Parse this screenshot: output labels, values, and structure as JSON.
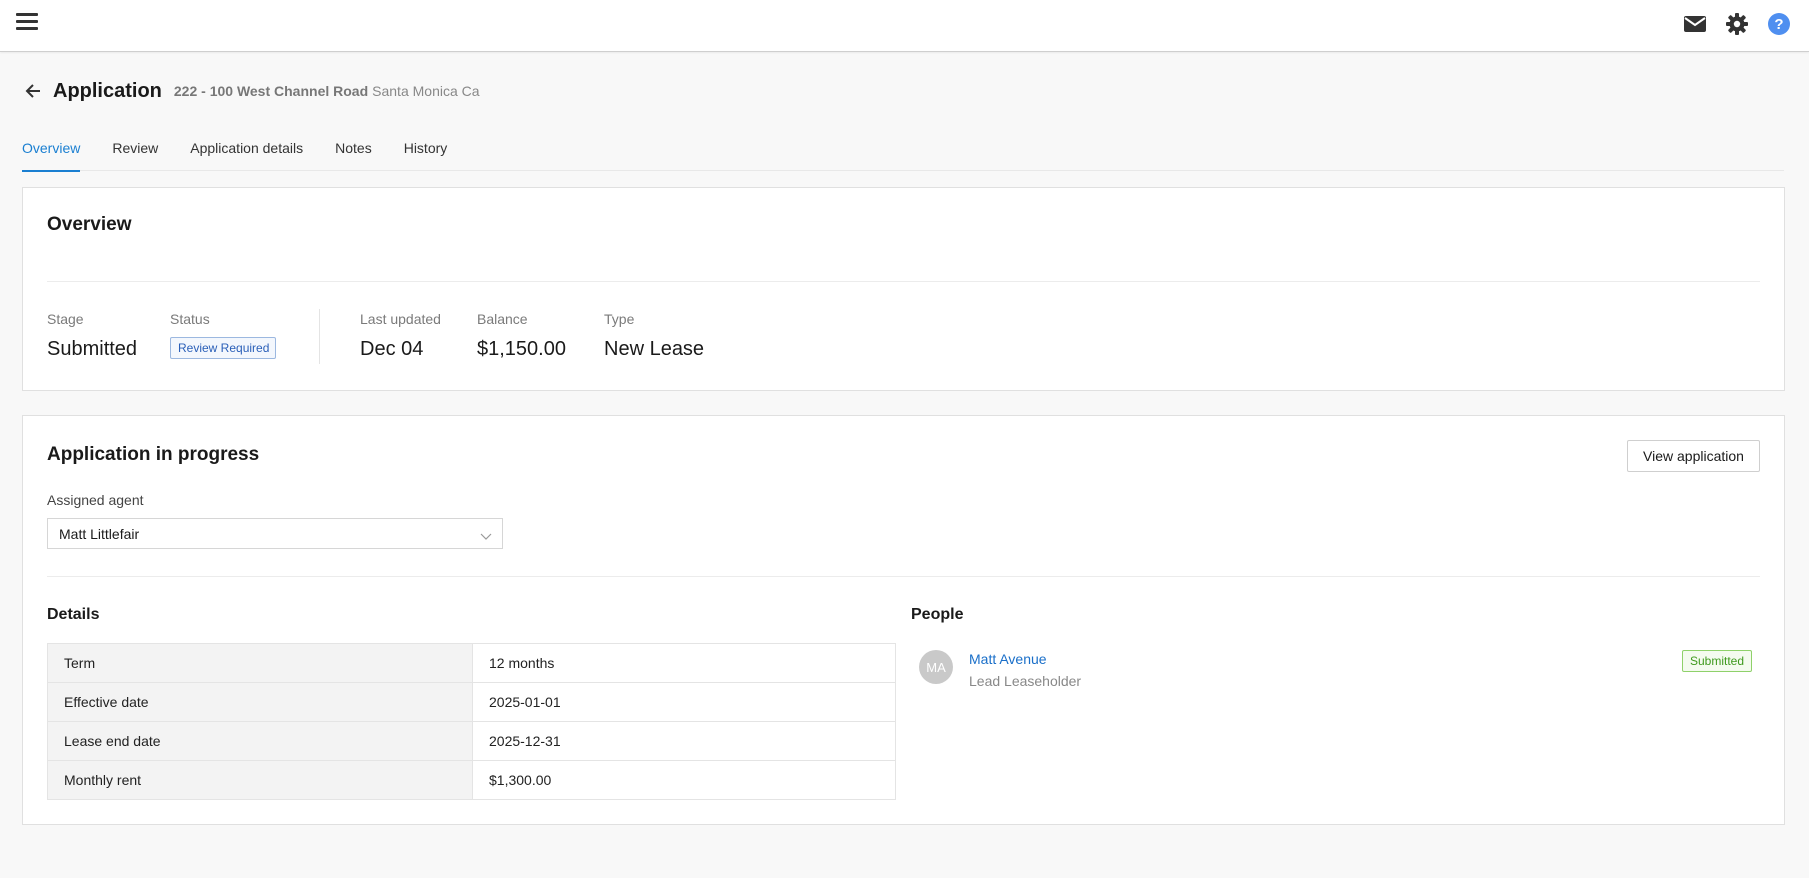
{
  "topbar": {
    "icons": [
      "menu-icon",
      "mail-icon",
      "gear-icon",
      "help-icon"
    ],
    "help_glyph": "?",
    "colors": {
      "help": "#4f8ff0",
      "icon": "#333333"
    }
  },
  "header": {
    "title": "Application",
    "address_bold": "222 - 100 West Channel Road",
    "address_city": "Santa Monica Ca"
  },
  "tabs": [
    {
      "label": "Overview",
      "active": true
    },
    {
      "label": "Review",
      "active": false
    },
    {
      "label": "Application details",
      "active": false
    },
    {
      "label": "Notes",
      "active": false
    },
    {
      "label": "History",
      "active": false
    }
  ],
  "overview": {
    "title": "Overview",
    "stats": {
      "stage": {
        "label": "Stage",
        "value": "Submitted"
      },
      "status": {
        "label": "Status",
        "value": "Review Required"
      },
      "last_updated": {
        "label": "Last updated",
        "value": "Dec 04"
      },
      "balance": {
        "label": "Balance",
        "value": "$1,150.00"
      },
      "type": {
        "label": "Type",
        "value": "New Lease"
      }
    }
  },
  "progress": {
    "title": "Application in progress",
    "view_button": "View application",
    "assigned_agent_label": "Assigned agent",
    "assigned_agent_value": "Matt Littlefair",
    "details_title": "Details",
    "details": [
      {
        "key": "Term",
        "value": "12 months"
      },
      {
        "key": "Effective date",
        "value": "2025-01-01"
      },
      {
        "key": "Lease end date",
        "value": "2025-12-31"
      },
      {
        "key": "Monthly rent",
        "value": "$1,300.00"
      }
    ],
    "people_title": "People",
    "people": [
      {
        "initials": "MA",
        "name": "Matt Avenue",
        "role": "Lead Leaseholder",
        "status": "Submitted"
      }
    ]
  },
  "colors": {
    "accent": "#1a7fd1",
    "link": "#1a6fc9",
    "status_review": "#2a5fb8",
    "status_submitted": "#3f9a1e"
  }
}
